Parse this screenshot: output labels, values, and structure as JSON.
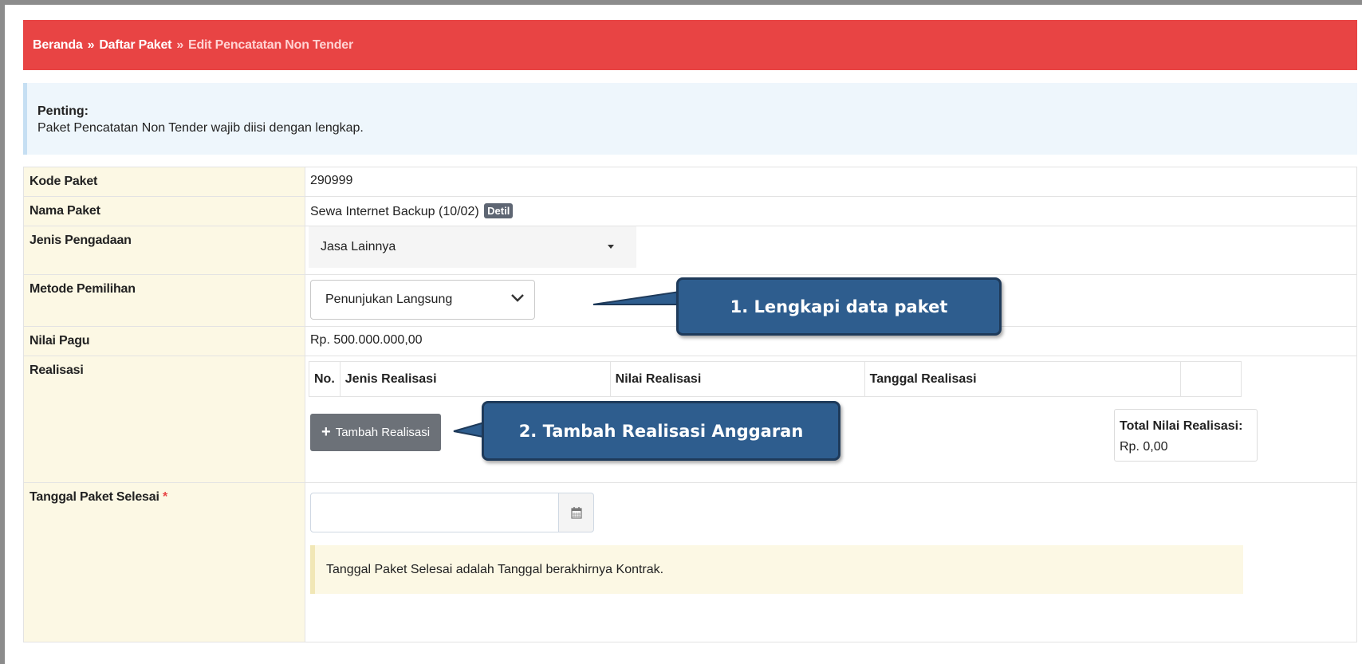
{
  "breadcrumb": {
    "home": "Beranda",
    "sep1": "»",
    "list": "Daftar Paket",
    "sep2": "»",
    "current": "Edit Pencatatan Non Tender"
  },
  "alert": {
    "title": "Penting:",
    "text": "Paket Pencatatan Non Tender wajib diisi dengan lengkap."
  },
  "form": {
    "kode_label": "Kode Paket",
    "kode_value": "290999",
    "nama_label": "Nama Paket",
    "nama_value": "Sewa Internet Backup (10/02)",
    "detil_badge": "Detil",
    "jenis_label": "Jenis Pengadaan",
    "jenis_value": "Jasa Lainnya",
    "metode_label": "Metode Pemilihan",
    "metode_value": "Penunjukan Langsung",
    "pagu_label": "Nilai Pagu",
    "pagu_value": "Rp. 500.000.000,00",
    "realisasi_label": "Realisasi",
    "realisasi_columns": [
      "No.",
      "Jenis Realisasi",
      "Nilai Realisasi",
      "Tanggal Realisasi",
      ""
    ],
    "tambah_button": "Tambah Realisasi",
    "total_label": "Total Nilai Realisasi:",
    "total_value": "Rp. 0,00",
    "tgl_label": "Tanggal Paket Selesai",
    "tgl_required": "*",
    "tgl_value": "",
    "tgl_hint": "Tanggal Paket Selesai adalah Tanggal berakhirnya Kontrak."
  },
  "callouts": {
    "step1": "1.   Lengkapi data paket",
    "step2": "2. Tambah Realisasi Anggaran"
  },
  "colors": {
    "breadcrumb_bg": "#e84444",
    "label_bg": "#fcf8e4",
    "callout_bg": "#2e5d8e"
  }
}
